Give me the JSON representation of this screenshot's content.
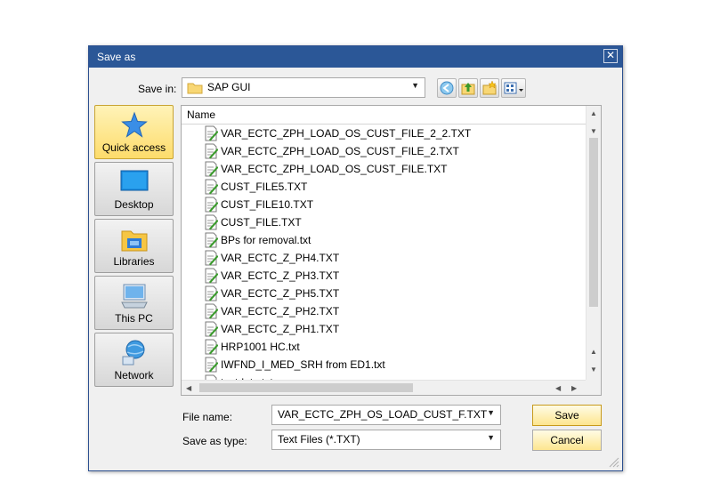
{
  "window": {
    "title": "Save as",
    "close_label": "✕"
  },
  "toolbar": {
    "save_in_label": "Save in:",
    "location": "SAP GUI",
    "buttons": [
      "back-icon",
      "up-folder-icon",
      "new-folder-icon",
      "view-menu-icon"
    ]
  },
  "places": [
    {
      "label": "Quick access",
      "icon": "star-icon"
    },
    {
      "label": "Desktop",
      "icon": "desktop-icon"
    },
    {
      "label": "Libraries",
      "icon": "libraries-icon"
    },
    {
      "label": "This PC",
      "icon": "computer-icon"
    },
    {
      "label": "Network",
      "icon": "network-icon"
    }
  ],
  "filelist": {
    "column_header": "Name",
    "files": [
      "VAR_ECTC_ZPH_LOAD_OS_CUST_FILE_2_2.TXT",
      "VAR_ECTC_ZPH_LOAD_OS_CUST_FILE_2.TXT",
      "VAR_ECTC_ZPH_LOAD_OS_CUST_FILE.TXT",
      "CUST_FILE5.TXT",
      "CUST_FILE10.TXT",
      "CUST_FILE.TXT",
      "BPs for removal.txt",
      "VAR_ECTC_Z_PH4.TXT",
      "VAR_ECTC_Z_PH3.TXT",
      "VAR_ECTC_Z_PH5.TXT",
      "VAR_ECTC_Z_PH2.TXT",
      "VAR_ECTC_Z_PH1.TXT",
      "HRP1001 HC.txt",
      "IWFND_I_MED_SRH from ED1.txt",
      "testdata.txt"
    ]
  },
  "form": {
    "filename_label": "File name:",
    "filename_value": "VAR_ECTC_ZPH_OS_LOAD_CUST_F.TXT",
    "type_label": "Save as type:",
    "type_value": "Text Files (*.TXT)"
  },
  "buttons": {
    "save": "Save",
    "cancel": "Cancel"
  }
}
